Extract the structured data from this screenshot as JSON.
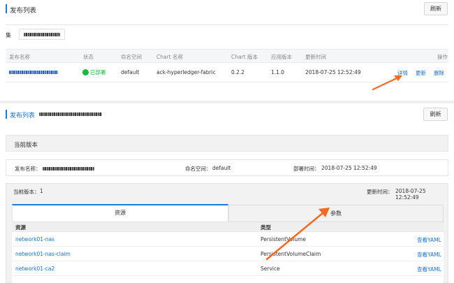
{
  "top": {
    "title": "发布列表",
    "refresh": "刷新",
    "cluster_label": "集",
    "table": {
      "headers": [
        "发布名称",
        "状态",
        "命名空间",
        "Chart 名称",
        "Chart 版本",
        "应用版本",
        "更新时间",
        "操作"
      ],
      "row": {
        "status": "已部署",
        "namespace": "default",
        "chart_name": "ack-hyperledger-fabric",
        "chart_version": "0.2.2",
        "app_version": "1.1.0",
        "updated": "2018-07-25 12:52:49",
        "actions": [
          "详情",
          "更新",
          "删除"
        ]
      }
    }
  },
  "detail": {
    "title": "发布列表",
    "refresh": "刷新",
    "current_version_title": "当前版本",
    "info": {
      "name_label": "发布名称：",
      "namespace_label": "命名空间：",
      "namespace_value": "default",
      "deploy_time_label": "部署时间：",
      "deploy_time_value": "2018-07-25 12:52:49"
    },
    "version_bar": {
      "current_label": "当前版本：",
      "current_value": "1",
      "updated_label": "更新时间：",
      "updated_value": "2018-07-25 12:52:49"
    },
    "tabs": [
      "资源",
      "参数"
    ],
    "resources": {
      "headers": [
        "资源",
        "类型"
      ],
      "rows": [
        {
          "name": "network01-nas",
          "type": "PersistentVolume",
          "action": "查看YAML"
        },
        {
          "name": "network01-nas-claim",
          "type": "PersistentVolumeClaim",
          "action": "查看YAML"
        },
        {
          "name": "network01-ca2",
          "type": "Service",
          "action": "查看YAML"
        }
      ]
    }
  },
  "colors": {
    "accent": "#1a7bd8",
    "arrow": "#f26b21",
    "success": "#18b83b"
  }
}
